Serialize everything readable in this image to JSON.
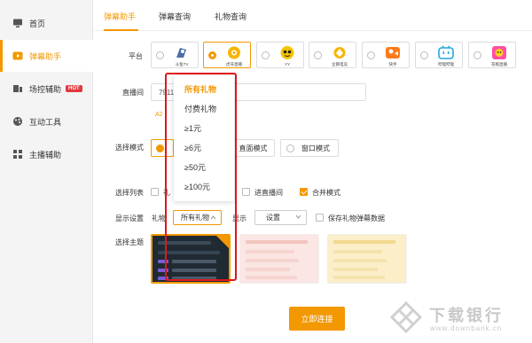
{
  "sidebar": {
    "items": [
      {
        "label": "首页",
        "icon": "monitor-icon"
      },
      {
        "label": "弹幕助手",
        "icon": "play-icon"
      },
      {
        "label": "场控辅助",
        "icon": "shield-icon",
        "badge": "HOT"
      },
      {
        "label": "互动工具",
        "icon": "palette-icon"
      },
      {
        "label": "主播辅助",
        "icon": "grid-icon"
      }
    ],
    "active_index": 1
  },
  "tabs": [
    {
      "label": "弹幕助手"
    },
    {
      "label": "弹幕查询"
    },
    {
      "label": "礼物查询"
    }
  ],
  "form": {
    "platform_label": "平台",
    "platforms": [
      {
        "name": "斗鱼TV",
        "color": "#4a6fa5"
      },
      {
        "name": "虎牙直播",
        "color": "#f39800"
      },
      {
        "name": "YY",
        "color": "#f5c400"
      },
      {
        "name": "企鹅电竞",
        "color": "#f7b500"
      },
      {
        "name": "快手",
        "color": "#ff7a1a"
      },
      {
        "name": "哔哩哔哩",
        "color": "#22a8e0"
      },
      {
        "name": "花椒直播",
        "color": "#ff4fa3"
      }
    ],
    "room_label": "直播间",
    "room_value": "7911",
    "room_hint": "A2",
    "mode_label": "选择模式",
    "modes": [
      "",
      "直面模式",
      "窗口模式"
    ],
    "list_label": "选择列表",
    "list_options": [
      {
        "label": "礼",
        "checked": false
      },
      {
        "label": "进直播间",
        "checked": false
      },
      {
        "label": "合并模式",
        "checked": true
      }
    ],
    "display_label": "显示设置",
    "gift_label": "礼物",
    "gift_select": "所有礼物",
    "display_sub": "显示",
    "settings_select": "设置",
    "save_gift_label": "保存礼物弹幕数据",
    "theme_label": "选择主题"
  },
  "dropdown": {
    "options": [
      "所有礼物",
      "付费礼物",
      "≥1元",
      "≥6元",
      "≥50元",
      "≥100元"
    ],
    "selected_index": 0
  },
  "connect_label": "立即连接",
  "watermark": {
    "title": "下载银行",
    "sub": "www.downbank.cn"
  },
  "colors": {
    "accent": "#f39800",
    "highlight": "#e0161b"
  }
}
